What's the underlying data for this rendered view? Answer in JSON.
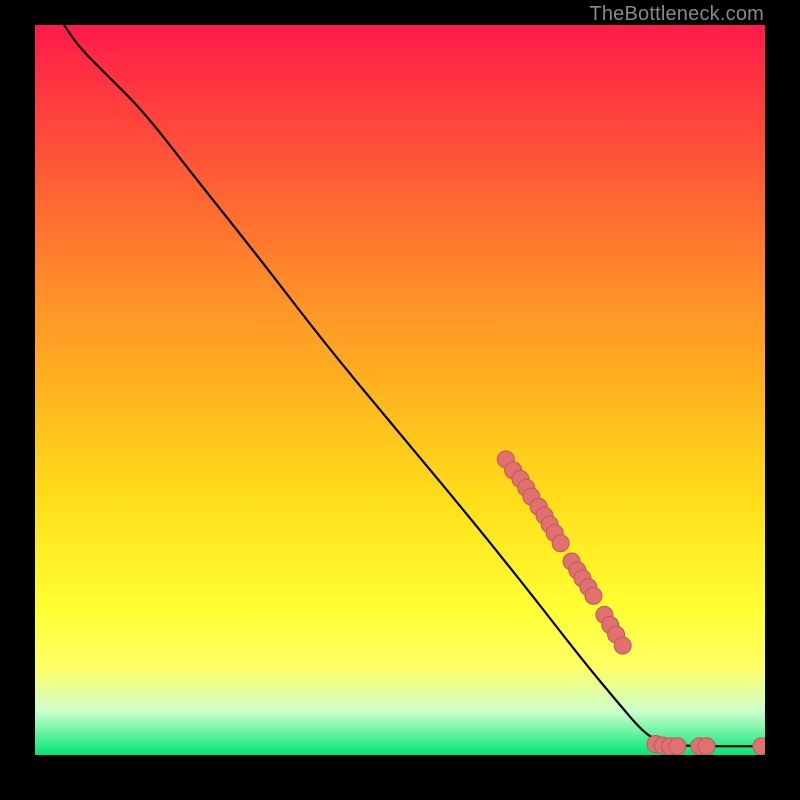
{
  "attribution": "TheBottleneck.com",
  "chart_data": {
    "type": "line",
    "title": "",
    "xlabel": "",
    "ylabel": "",
    "xlim": [
      0,
      100
    ],
    "ylim": [
      0,
      100
    ],
    "curve": [
      {
        "x": 4,
        "y": 100
      },
      {
        "x": 6,
        "y": 97
      },
      {
        "x": 10,
        "y": 93
      },
      {
        "x": 15,
        "y": 88
      },
      {
        "x": 22,
        "y": 79
      },
      {
        "x": 30,
        "y": 69
      },
      {
        "x": 40,
        "y": 56
      },
      {
        "x": 50,
        "y": 44
      },
      {
        "x": 60,
        "y": 32
      },
      {
        "x": 68,
        "y": 22
      },
      {
        "x": 75,
        "y": 13
      },
      {
        "x": 80,
        "y": 7
      },
      {
        "x": 83,
        "y": 3.5
      },
      {
        "x": 85,
        "y": 2
      },
      {
        "x": 88,
        "y": 1.3
      },
      {
        "x": 92,
        "y": 1.2
      },
      {
        "x": 100,
        "y": 1.2
      }
    ],
    "scatter": [
      {
        "x": 64.5,
        "y": 40.5
      },
      {
        "x": 65.5,
        "y": 39.0
      },
      {
        "x": 66.5,
        "y": 37.8
      },
      {
        "x": 67.3,
        "y": 36.6
      },
      {
        "x": 68.0,
        "y": 35.4
      },
      {
        "x": 69.0,
        "y": 34.0
      },
      {
        "x": 69.8,
        "y": 32.8
      },
      {
        "x": 70.5,
        "y": 31.6
      },
      {
        "x": 71.2,
        "y": 30.4
      },
      {
        "x": 72.0,
        "y": 29.0
      },
      {
        "x": 73.5,
        "y": 26.5
      },
      {
        "x": 74.3,
        "y": 25.3
      },
      {
        "x": 75.0,
        "y": 24.2
      },
      {
        "x": 75.8,
        "y": 23.0
      },
      {
        "x": 76.5,
        "y": 21.8
      },
      {
        "x": 78.0,
        "y": 19.2
      },
      {
        "x": 78.8,
        "y": 17.8
      },
      {
        "x": 79.6,
        "y": 16.5
      },
      {
        "x": 80.5,
        "y": 15.0
      },
      {
        "x": 85.0,
        "y": 1.5
      },
      {
        "x": 86.0,
        "y": 1.3
      },
      {
        "x": 87.0,
        "y": 1.2
      },
      {
        "x": 88.0,
        "y": 1.2
      },
      {
        "x": 91.0,
        "y": 1.2
      },
      {
        "x": 92.0,
        "y": 1.2
      },
      {
        "x": 99.5,
        "y": 1.2
      }
    ],
    "colors": {
      "curve": "#000000",
      "scatter_fill": "#e27070",
      "scatter_stroke": "#bb5a5a"
    }
  }
}
